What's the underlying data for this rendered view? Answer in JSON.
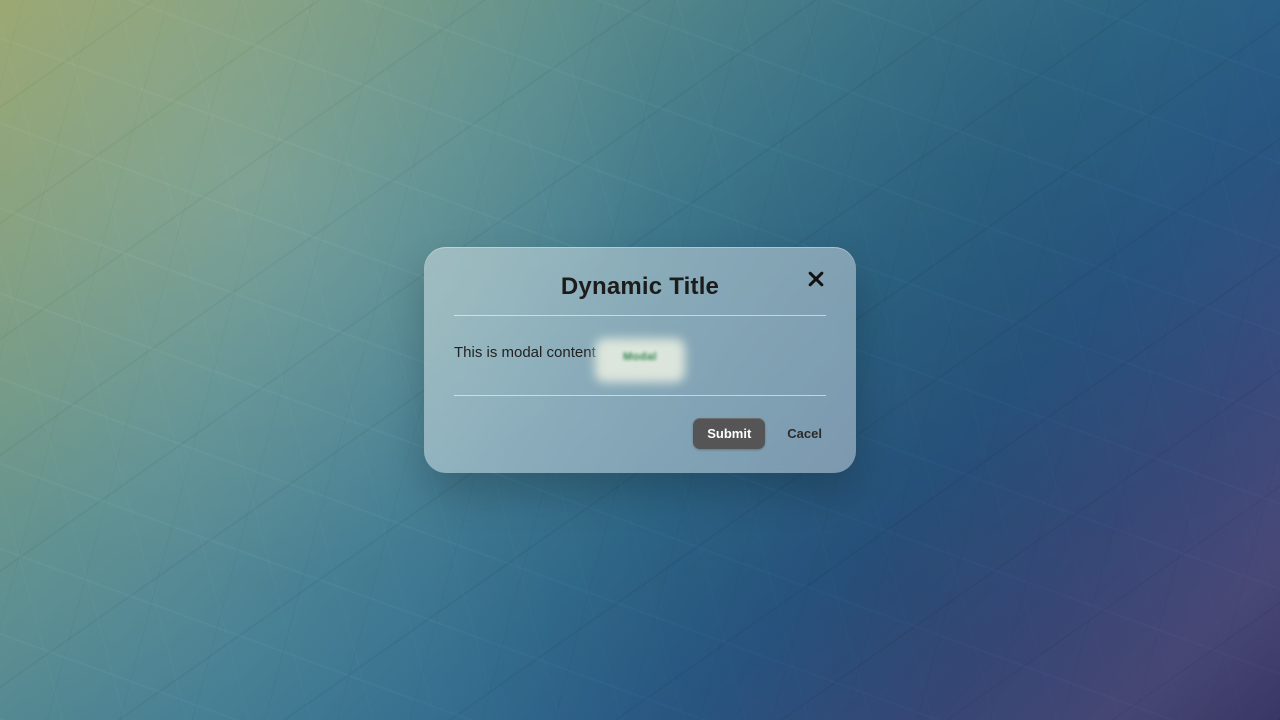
{
  "modal": {
    "title": "Dynamic Title",
    "body_text": "This is modal content",
    "ghost_button_label": "Modal",
    "close_icon": "close-icon",
    "footer": {
      "submit_label": "Submit",
      "cancel_label": "Cacel"
    }
  }
}
